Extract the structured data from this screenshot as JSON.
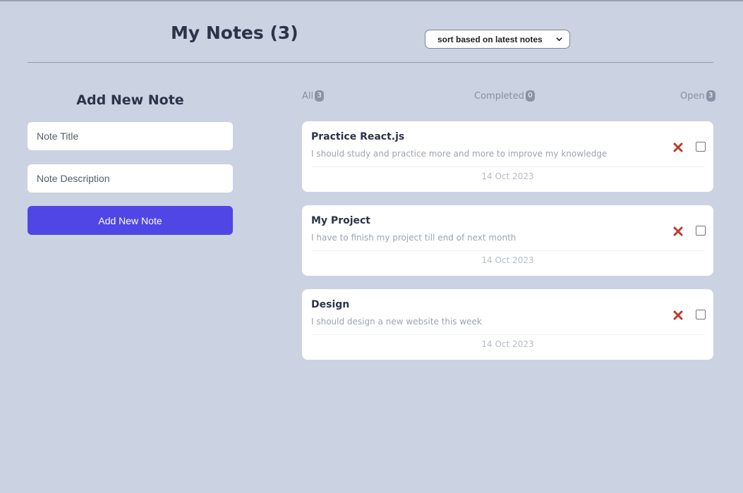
{
  "header": {
    "title": "My Notes (3)",
    "sort": {
      "selected": "sort based on latest notes"
    }
  },
  "form": {
    "title": "Add New Note",
    "title_placeholder": "Note Title",
    "description_placeholder": "Note Description",
    "submit_label": "Add New Note"
  },
  "filters": [
    {
      "label": "All",
      "count": "3"
    },
    {
      "label": "Completed",
      "count": "0"
    },
    {
      "label": "Open",
      "count": "3"
    }
  ],
  "notes": [
    {
      "title": "Practice React.js",
      "description": "I should study and practice more and more to improve my knowledge",
      "date": "14 Oct 2023"
    },
    {
      "title": "My Project",
      "description": "I have to finish my project till end of next month",
      "date": "14 Oct 2023"
    },
    {
      "title": "Design",
      "description": "I should design a new website this week",
      "date": "14 Oct 2023"
    }
  ],
  "colors": {
    "background": "#cbd2e2",
    "accent": "#4f46e5",
    "delete": "#c0392b"
  },
  "icons": {
    "delete": "close-x-icon",
    "sort": "chevron-down-icon"
  }
}
